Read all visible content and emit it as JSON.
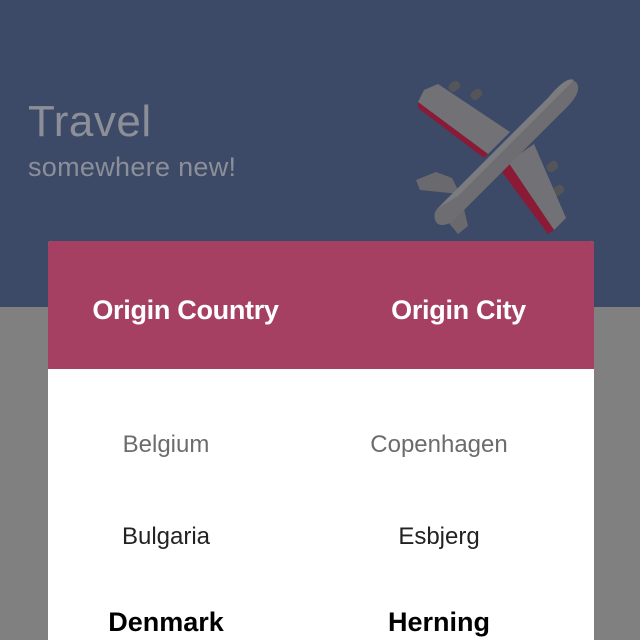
{
  "hero": {
    "title": "Travel",
    "subtitle": "somewhere new!"
  },
  "table": {
    "headers": {
      "country": "Origin Country",
      "city": "Origin City"
    },
    "country_options": [
      "Belgium",
      "Bulgaria",
      "Denmark"
    ],
    "city_options": [
      "Copenhagen",
      "Esbjerg",
      "Herning"
    ],
    "selected": {
      "country": "Denmark",
      "city": "Herning"
    }
  },
  "colors": {
    "hero_background": "#3c4a68",
    "page_background": "#808080",
    "header_accent": "#a64062",
    "plane_body": "#6e6e72",
    "plane_accent": "#8a1a35"
  },
  "icons": {
    "illustration": "airplane-icon"
  }
}
